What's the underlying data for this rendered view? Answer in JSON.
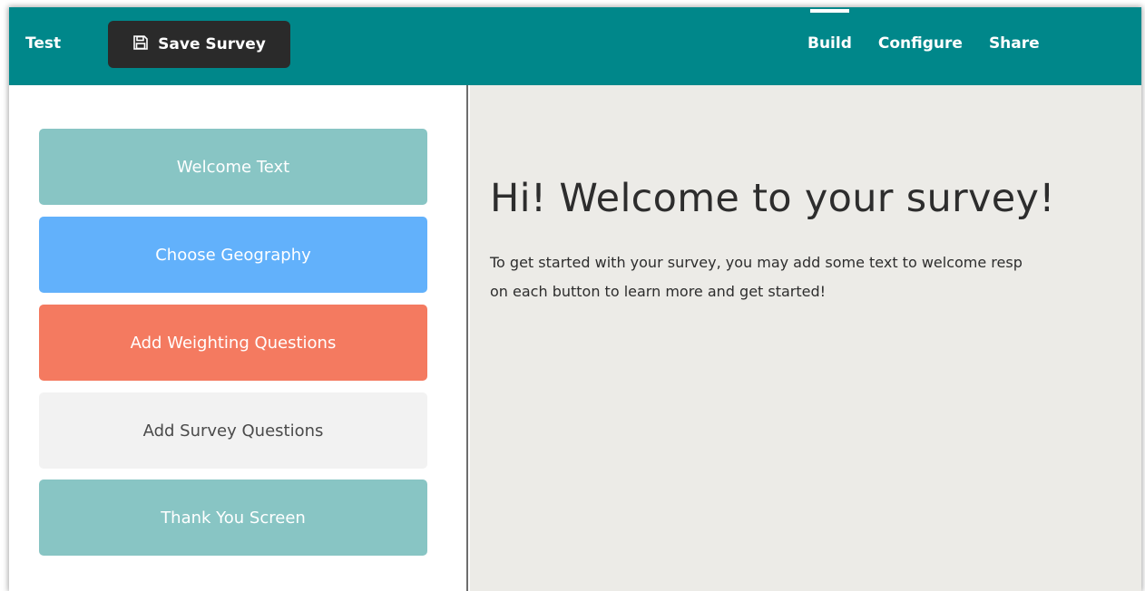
{
  "header": {
    "app_title": "Test",
    "save_label": "Save Survey",
    "save_icon": "floppy-disk-icon",
    "nav_tabs": [
      {
        "label": "Build",
        "active": true
      },
      {
        "label": "Configure",
        "active": false
      },
      {
        "label": "Share",
        "active": false
      }
    ]
  },
  "sidebar": {
    "steps": [
      {
        "label": "Welcome Text",
        "color": "#88c5c4",
        "text_color": "#ffffff"
      },
      {
        "label": "Choose Geography",
        "color": "#62b1fb",
        "text_color": "#ffffff"
      },
      {
        "label": "Add Weighting Questions",
        "color": "#f47a60",
        "text_color": "#ffffff"
      },
      {
        "label": "Add Survey Questions",
        "color": "#f2f2f2",
        "text_color": "#4a4a4a"
      },
      {
        "label": "Thank You Screen",
        "color": "#88c5c4",
        "text_color": "#ffffff"
      }
    ]
  },
  "main": {
    "heading": "Hi! Welcome to your survey!",
    "body_line1": "To get started with your survey, you may add some text to welcome resp",
    "body_line2": "on each button to learn more and get started!"
  },
  "colors": {
    "header_bg": "#00878a",
    "save_button_bg": "#2a2a2a",
    "main_bg": "#ecebe7"
  }
}
